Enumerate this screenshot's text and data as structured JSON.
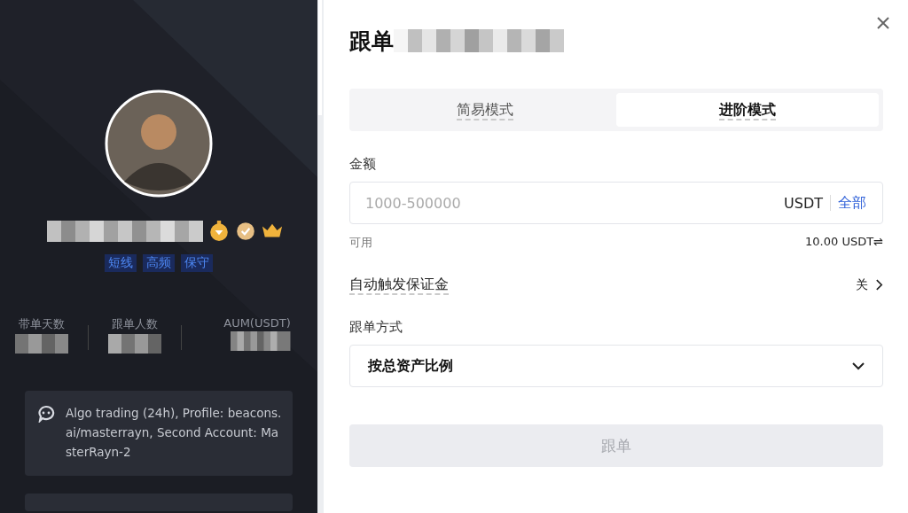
{
  "profile": {
    "tags": [
      "短线",
      "高频",
      "保守"
    ],
    "stats": [
      {
        "label": "带单天数"
      },
      {
        "label": "跟单人数"
      },
      {
        "label": "AUM(USDT)"
      }
    ],
    "bio": "Algo trading (24h), Profile: beacons.ai/masterrayn, Second Account: MasterRayn-2"
  },
  "dialog": {
    "title": "跟单",
    "tabs": [
      {
        "label": "简易模式",
        "selected": false
      },
      {
        "label": "进阶模式",
        "selected": true
      }
    ],
    "amount": {
      "label": "金额",
      "placeholder": "1000-500000",
      "unit": "USDT",
      "max_link": "全部"
    },
    "available": {
      "label": "可用",
      "value": "10.00 USDT⇌"
    },
    "auto_margin": {
      "label": "自动触发保证金",
      "value": "关",
      "on": false
    },
    "mode": {
      "label": "跟单方式",
      "value": "按总资产比例"
    },
    "submit": {
      "label": "跟单",
      "disabled": true
    }
  }
}
